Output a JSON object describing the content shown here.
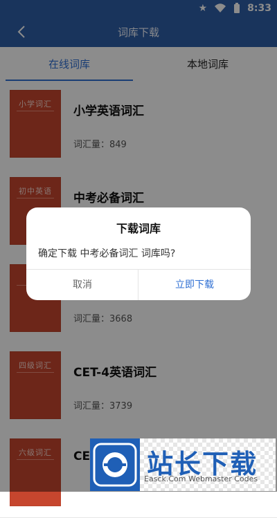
{
  "status": {
    "time": "8:33"
  },
  "appbar": {
    "title": "词库下载"
  },
  "tabs": [
    {
      "label": "在线词库"
    },
    {
      "label": "本地词库"
    }
  ],
  "items": [
    {
      "name": "小学英语词汇",
      "count": "词汇量：849",
      "cover_title": "小学词汇"
    },
    {
      "name": "中考必备词汇",
      "count": "",
      "cover_title": "初中英语"
    },
    {
      "name": "",
      "count": "词汇量：3668",
      "cover_title": "高"
    },
    {
      "name": "CET-4英语词汇",
      "count": "词汇量：3739",
      "cover_title": "四级词汇"
    },
    {
      "name": "CE",
      "count": "",
      "cover_title": "六级词汇"
    }
  ],
  "dialog": {
    "title": "下载词库",
    "message": "确定下载 中考必备词汇 词库吗?",
    "cancel": "取消",
    "confirm": "立即下载"
  },
  "watermark": {
    "text": "站长下载",
    "sub": "Easck.Com Webmaster Codes"
  }
}
